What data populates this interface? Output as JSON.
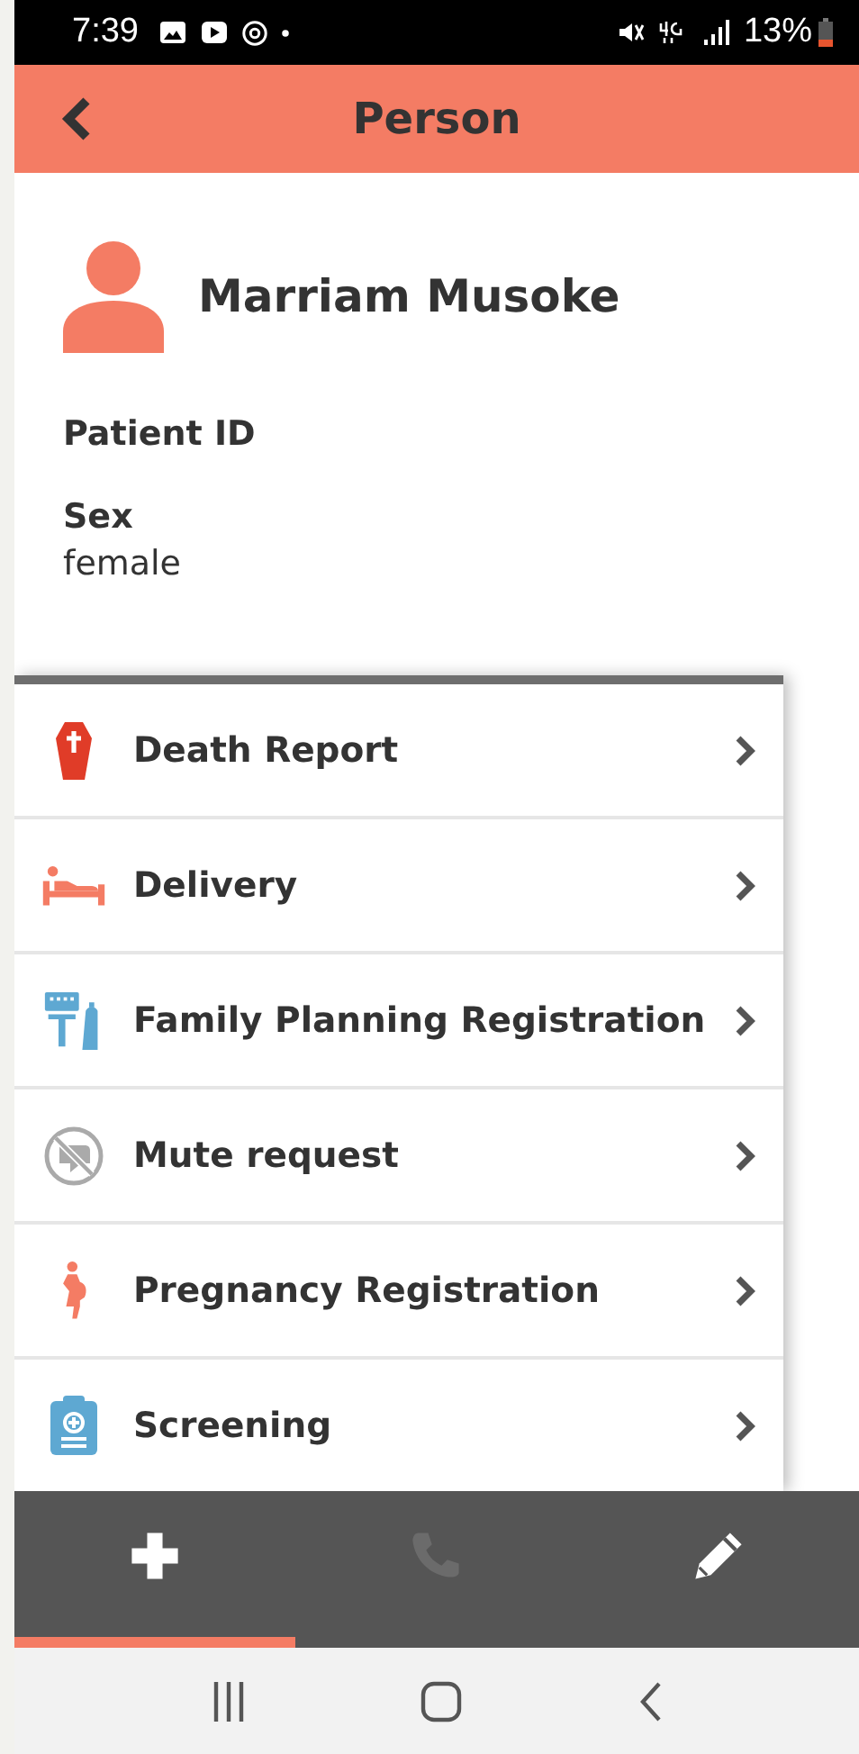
{
  "status_bar": {
    "time": "7:39",
    "battery": "13%"
  },
  "header": {
    "title": "Person"
  },
  "person": {
    "name": "Marriam Musoke"
  },
  "fields": [
    {
      "label": "Patient ID"
    },
    {
      "label": "Sex",
      "value": "female"
    }
  ],
  "action_menu": {
    "items": [
      {
        "label": "Death Report",
        "kind": "death"
      },
      {
        "label": "Delivery",
        "kind": "delivery"
      },
      {
        "label": "Family Planning Registration",
        "kind": "family-planning"
      },
      {
        "label": "Mute request",
        "kind": "mute"
      },
      {
        "label": "Pregnancy Registration",
        "kind": "pregnancy"
      },
      {
        "label": "Screening",
        "kind": "screening"
      }
    ]
  },
  "bottom_bar": {
    "actions": [
      {
        "kind": "add",
        "disabled": false,
        "selected": true
      },
      {
        "kind": "call",
        "disabled": true,
        "selected": false
      },
      {
        "kind": "edit",
        "disabled": false,
        "selected": false
      }
    ]
  }
}
